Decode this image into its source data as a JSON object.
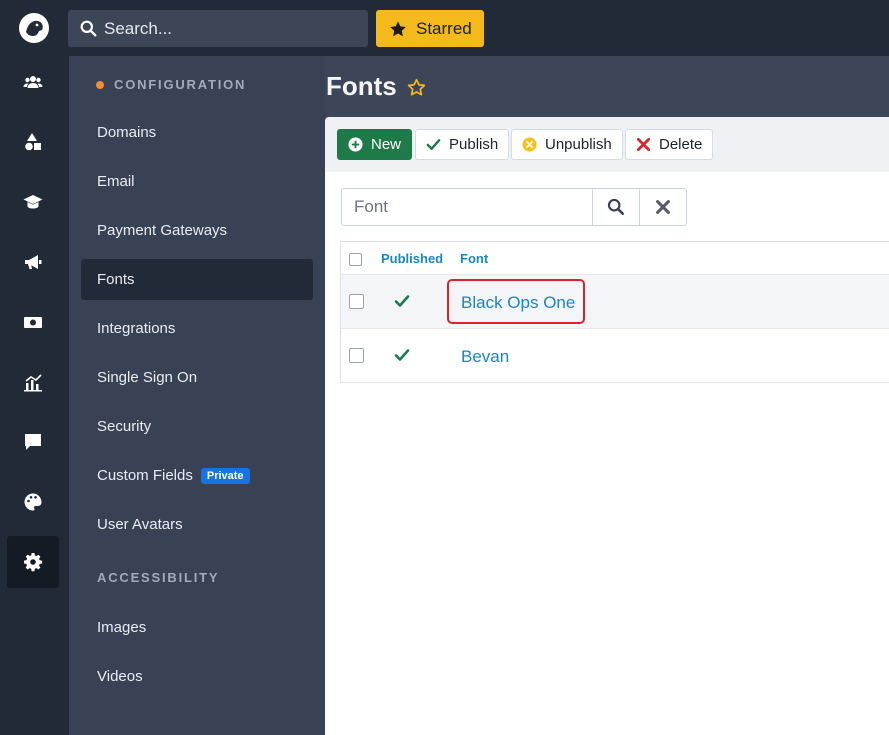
{
  "topbar": {
    "search_placeholder": "Search...",
    "starred_label": "Starred"
  },
  "rail": {
    "items": [
      {
        "icon": "users-icon"
      },
      {
        "icon": "shapes-icon"
      },
      {
        "icon": "graduation-cap-icon"
      },
      {
        "icon": "megaphone-icon"
      },
      {
        "icon": "money-icon"
      },
      {
        "icon": "analytics-icon"
      },
      {
        "icon": "comment-icon"
      },
      {
        "icon": "palette-icon"
      },
      {
        "icon": "gear-icon",
        "active": true
      }
    ]
  },
  "sidebar": {
    "section1": "CONFIGURATION",
    "items": [
      {
        "label": "Domains"
      },
      {
        "label": "Email"
      },
      {
        "label": "Payment Gateways"
      },
      {
        "label": "Fonts",
        "active": true
      },
      {
        "label": "Integrations"
      },
      {
        "label": "Single Sign On"
      },
      {
        "label": "Security"
      },
      {
        "label": "Custom Fields",
        "badge": "Private"
      },
      {
        "label": "User Avatars"
      }
    ],
    "section2": "ACCESSIBILITY",
    "items2": [
      {
        "label": "Images"
      },
      {
        "label": "Videos"
      }
    ]
  },
  "main": {
    "title": "Fonts",
    "toolbar": {
      "new_label": "New",
      "publish_label": "Publish",
      "unpublish_label": "Unpublish",
      "delete_label": "Delete"
    },
    "filter_placeholder": "Font",
    "table": {
      "headers": {
        "published": "Published",
        "font": "Font"
      },
      "rows": [
        {
          "published": true,
          "font": "Black Ops One"
        },
        {
          "published": true,
          "font": "Bevan"
        }
      ]
    }
  },
  "colors": {
    "accent_dot": "#f08c34",
    "starred_bg": "#f4b91b",
    "primary_btn": "#1f7a4a",
    "link": "#1a86c0",
    "highlight_box": "#d6252e"
  }
}
